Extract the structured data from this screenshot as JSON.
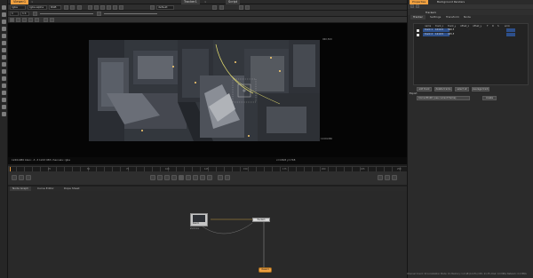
{
  "viewer_tabs": [
    {
      "label": "Viewer1"
    },
    {
      "label": "Tracker1"
    },
    {
      "label": "Script"
    }
  ],
  "viewer_controls": {
    "layer": "rgba",
    "channel": "rgba.alpha",
    "colorspace": "RGB",
    "zoom": "default",
    "frame": "1",
    "proxy": "1:1"
  },
  "viewer_status": {
    "left": "1240x980  bbox: -3 -3 1243 983 channels: rgba",
    "middle": "x=1818 y=748",
    "format_corner_tr": "960,500",
    "format_corner_br": "1240x980"
  },
  "timeline_ticks": [
    "1",
    "25",
    "50",
    "75",
    "100",
    "125",
    "150",
    "175",
    "200",
    "225",
    "250"
  ],
  "graph_tabs": [
    {
      "label": "Node Graph"
    },
    {
      "label": "Curve Editor"
    },
    {
      "label": "Dope Sheet"
    }
  ],
  "nodes": {
    "read": {
      "label": "Read1",
      "sub": "shot.mov"
    },
    "tracker": {
      "label": "Tracker1"
    },
    "viewer": {
      "label": "Viewer1"
    }
  },
  "panel": {
    "top_tabs": [
      {
        "label": "Properties"
      },
      {
        "label": "Background Renders"
      }
    ],
    "node_name": "Tracker1",
    "sub_tabs": [
      {
        "label": "Tracker"
      },
      {
        "label": "Settings"
      },
      {
        "label": "Transform"
      },
      {
        "label": "Node"
      }
    ],
    "table_headers": [
      "name",
      "track_x",
      "track_y",
      "offset_x",
      "offset_y",
      "T",
      "R",
      "S",
      "error"
    ],
    "tracks": [
      {
        "name": "track 1",
        "track_x": "1010.5",
        "track_y": "560.5"
      },
      {
        "name": "track 2",
        "track_x": "1210.5",
        "track_y": "425.5"
      }
    ],
    "action_buttons": [
      "add track",
      "delete tracks",
      "select all",
      "average tracks"
    ],
    "export_label": "Export",
    "export_value": "CornerPin2D (use current frame)",
    "create_label": "create"
  },
  "statusbar": "Channel Count: 10  Localization Mode: On  Memory: 1.4 GB (14.9%)  CPU: 21.3%  Disk: 0.0 MB/s  Network: 0.0 MB/s",
  "colors": {
    "accent": "#f0a040",
    "selection": "#2d4f8a",
    "background": "#1e1e1e",
    "panel": "#2b2b2b"
  }
}
